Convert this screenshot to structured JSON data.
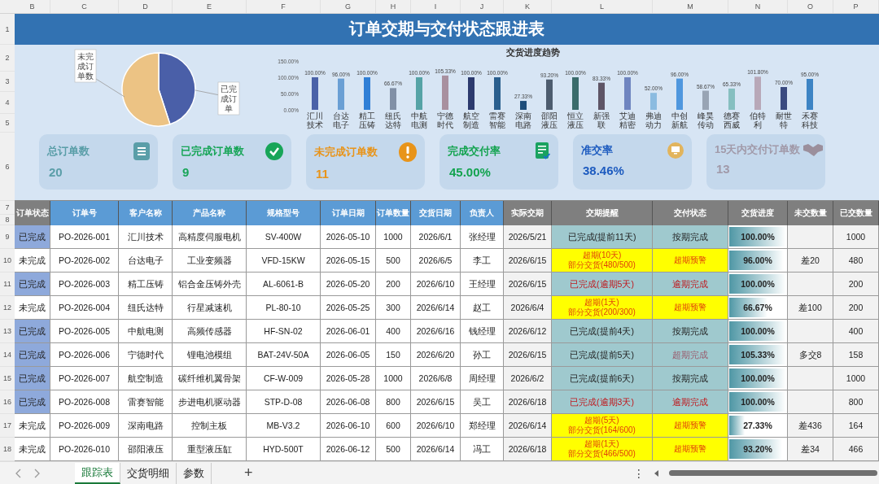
{
  "column_letters": [
    "B",
    "C",
    "D",
    "E",
    "F",
    "G",
    "H",
    "I",
    "J",
    "K",
    "L",
    "M",
    "N",
    "O",
    "P"
  ],
  "row_numbers": [
    "1",
    "2",
    "3",
    "4",
    "5",
    "6",
    "7",
    "8",
    "9",
    "10",
    "11",
    "12",
    "13",
    "14",
    "15",
    "16",
    "17",
    "18"
  ],
  "title": "订单交期与交付状态跟进表",
  "pie": {
    "labels": [
      "未完成订单数",
      "已完成订单"
    ]
  },
  "trend": {
    "chart_data": {
      "type": "bar",
      "title": "交货进度趋势",
      "categories": [
        "汇川技术",
        "台达电子",
        "精工压铸",
        "纽氏达特",
        "中航电测",
        "宁德时代",
        "航空制造",
        "雷赛智能",
        "深南电路",
        "邵阳液压",
        "恒立液压",
        "新强联",
        "艾迪精密",
        "弗迪动力",
        "中创新航",
        "峰昊传动",
        "德赛西威",
        "伯特利",
        "耐世特",
        "禾赛科技"
      ],
      "values": [
        1,
        0.96,
        1,
        0.6667,
        1,
        1.0533,
        1,
        1,
        0.2733,
        0.932,
        1,
        0.8333,
        1,
        0.52,
        0.96,
        0.5867,
        0.6533,
        1.018,
        0.7,
        0.95
      ],
      "value_labels": [
        "100.00%",
        "96.00%",
        "100.00%",
        "66.67%",
        "100.00%",
        "105.33%",
        "100.00%",
        "100.00%",
        "27.33%",
        "93.20%",
        "100.00%",
        "83.33%",
        "100.00%",
        "52.00%",
        "96.00%",
        "58.67%",
        "65.33%",
        "101.80%",
        "70.00%",
        "95.00%"
      ],
      "ylim": [
        0,
        1.5
      ],
      "yticks": [
        {
          "value": 0,
          "label": "0.00%"
        },
        {
          "value": 0.5,
          "label": "50.00%"
        },
        {
          "value": 1,
          "label": "100.00%"
        },
        {
          "value": 1.5,
          "label": "150.00%"
        }
      ]
    }
  },
  "kpis": [
    {
      "label": "总订单数",
      "value": "20",
      "color": "#5a9ea8",
      "kind": "list"
    },
    {
      "label": "已完成订单数",
      "value": "9",
      "color": "#18a558",
      "kind": "check"
    },
    {
      "label": "未完成订单数",
      "value": "11",
      "color": "#e8941a",
      "kind": "alert"
    },
    {
      "label": "完成交付率",
      "value": "45.00%",
      "color": "#13a34f",
      "kind": "doc"
    },
    {
      "label": "准交率",
      "value": "38.46%",
      "color": "#1d5bbf",
      "kind": "monitor"
    },
    {
      "label": "15天内交付订单数",
      "value": "13",
      "color": "#a19aa9",
      "kind": "handshake"
    }
  ],
  "table": {
    "columns": [
      {
        "label": "订单状态",
        "kind": "grey"
      },
      {
        "label": "订单号",
        "kind": "blue"
      },
      {
        "label": "客户名称",
        "kind": "blue"
      },
      {
        "label": "产品名称",
        "kind": "blue"
      },
      {
        "label": "规格型号",
        "kind": "blue"
      },
      {
        "label": "订单日期",
        "kind": "blue"
      },
      {
        "label": "订单数量",
        "kind": "blue"
      },
      {
        "label": "交货日期",
        "kind": "blue"
      },
      {
        "label": "负责人",
        "kind": "blue"
      },
      {
        "label": "实际交期",
        "kind": "grey"
      },
      {
        "label": "交期提醒",
        "kind": "grey"
      },
      {
        "label": "交付状态",
        "kind": "grey"
      },
      {
        "label": "交货进度",
        "kind": "grey"
      },
      {
        "label": "未交数量",
        "kind": "grey"
      },
      {
        "label": "已交数量",
        "kind": "grey"
      }
    ],
    "rows": [
      {
        "status": "已完成",
        "completed": true,
        "order_no": "PO-2026-001",
        "customer": "汇川技术",
        "product": "高精度伺服电机",
        "model": "SV-400W",
        "order_date": "2026-05-10",
        "qty": "1000",
        "due_date": "2026/6/1",
        "owner": "张经理",
        "actual_date": "2026/5/21",
        "reminder": {
          "text": "已完成(提前11天)",
          "kind": "on_time"
        },
        "delivery_status": {
          "text": "按期完成",
          "kind": "on_time"
        },
        "progress": "100.00%",
        "level": 1,
        "delivered": "1000"
      },
      {
        "status": "未完成",
        "completed": false,
        "order_no": "PO-2026-002",
        "customer": "台达电子",
        "product": "工业变频器",
        "model": "VFD-15KW",
        "order_date": "2026-05-15",
        "qty": "500",
        "due_date": "2026/6/5",
        "owner": "李工",
        "actual_date": "2026/6/15",
        "reminder": {
          "text": "超期(10天)\n部分交货(480/500)",
          "kind": "overdue"
        },
        "delivery_status": {
          "text": "超期预警",
          "kind": "overdue"
        },
        "progress": "96.00%",
        "level": 0.96,
        "shortfall": "差20",
        "delivered": "480"
      },
      {
        "status": "已完成",
        "completed": true,
        "order_no": "PO-2026-003",
        "customer": "精工压铸",
        "product": "铝合金压铸外壳",
        "model": "AL-6061-B",
        "order_date": "2026-05-20",
        "qty": "200",
        "due_date": "2026/6/10",
        "owner": "王经理",
        "actual_date": "2026/6/15",
        "reminder": {
          "text": "已完成(逾期5天)",
          "kind": "late_done"
        },
        "delivery_status": {
          "text": "逾期完成",
          "kind": "late_done"
        },
        "progress": "100.00%",
        "level": 1,
        "delivered": "200"
      },
      {
        "status": "未完成",
        "completed": false,
        "order_no": "PO-2026-004",
        "customer": "纽氏达特",
        "product": "行星减速机",
        "model": "PL-80-10",
        "order_date": "2026-05-25",
        "qty": "300",
        "due_date": "2026/6/14",
        "owner": "赵工",
        "actual_date": "2026/6/4",
        "reminder": {
          "text": "超期(1天)\n部分交货(200/300)",
          "kind": "overdue"
        },
        "delivery_status": {
          "text": "超期预警",
          "kind": "overdue"
        },
        "progress": "66.67%",
        "level": 0.6667,
        "shortfall": "差100",
        "delivered": "200"
      },
      {
        "status": "已完成",
        "completed": true,
        "order_no": "PO-2026-005",
        "customer": "中航电测",
        "product": "高频传感器",
        "model": "HF-SN-02",
        "order_date": "2026-06-01",
        "qty": "400",
        "due_date": "2026/6/16",
        "owner": "钱经理",
        "actual_date": "2026/6/12",
        "reminder": {
          "text": "已完成(提前4天)",
          "kind": "on_time"
        },
        "delivery_status": {
          "text": "按期完成",
          "kind": "on_time"
        },
        "progress": "100.00%",
        "level": 1,
        "delivered": "400"
      },
      {
        "status": "已完成",
        "completed": true,
        "order_no": "PO-2026-006",
        "customer": "宁德时代",
        "product": "锂电池模组",
        "model": "BAT-24V-50A",
        "order_date": "2026-06-05",
        "qty": "150",
        "due_date": "2026/6/20",
        "owner": "孙工",
        "actual_date": "2026/6/15",
        "reminder": {
          "text": "已完成(提前5天)",
          "kind": "on_time"
        },
        "delivery_status": {
          "text": "超期完成",
          "kind": "over_done"
        },
        "progress": "105.33%",
        "level": 1,
        "shortfall": "多交8",
        "delivered": "158"
      },
      {
        "status": "已完成",
        "completed": true,
        "order_no": "PO-2026-007",
        "customer": "航空制造",
        "product": "碳纤维机翼骨架",
        "model": "CF-W-009",
        "order_date": "2026-05-28",
        "qty": "1000",
        "due_date": "2026/6/8",
        "owner": "周经理",
        "actual_date": "2026/6/2",
        "reminder": {
          "text": "已完成(提前6天)",
          "kind": "on_time"
        },
        "delivery_status": {
          "text": "按期完成",
          "kind": "on_time"
        },
        "progress": "100.00%",
        "level": 1,
        "delivered": "1000"
      },
      {
        "status": "已完成",
        "completed": true,
        "order_no": "PO-2026-008",
        "customer": "雷赛智能",
        "product": "步进电机驱动器",
        "model": "STP-D-08",
        "order_date": "2026-06-08",
        "qty": "800",
        "due_date": "2026/6/15",
        "owner": "吴工",
        "actual_date": "2026/6/18",
        "reminder": {
          "text": "已完成(逾期3天)",
          "kind": "late_done"
        },
        "delivery_status": {
          "text": "逾期完成",
          "kind": "late_done"
        },
        "progress": "100.00%",
        "level": 1,
        "delivered": "800"
      },
      {
        "status": "未完成",
        "completed": false,
        "order_no": "PO-2026-009",
        "customer": "深南电路",
        "product": "控制主板",
        "model": "MB-V3.2",
        "order_date": "2026-06-10",
        "qty": "600",
        "due_date": "2026/6/10",
        "owner": "郑经理",
        "actual_date": "2026/6/14",
        "reminder": {
          "text": "超期(5天)\n部分交货(164/600)",
          "kind": "overdue"
        },
        "delivery_status": {
          "text": "超期预警",
          "kind": "overdue"
        },
        "progress": "27.33%",
        "level": 0.2733,
        "shortfall": "差436",
        "delivered": "164"
      },
      {
        "status": "未完成",
        "completed": false,
        "order_no": "PO-2026-010",
        "customer": "邵阳液压",
        "product": "重型液压缸",
        "model": "HYD-500T",
        "order_date": "2026-06-12",
        "qty": "500",
        "due_date": "2026/6/14",
        "owner": "冯工",
        "actual_date": "2026/6/18",
        "reminder": {
          "text": "超期(1天)\n部分交货(466/500)",
          "kind": "overdue"
        },
        "delivery_status": {
          "text": "超期预警",
          "kind": "overdue"
        },
        "progress": "93.20%",
        "level": 0.932,
        "shortfall": "差34",
        "delivered": "466"
      }
    ]
  },
  "sheet_tabs": [
    {
      "label": "跟踪表",
      "selected": true
    },
    {
      "label": "交货明细",
      "selected": false
    },
    {
      "label": "参数",
      "selected": false
    }
  ],
  "add_sheet": "+",
  "more_menu": "⋮"
}
